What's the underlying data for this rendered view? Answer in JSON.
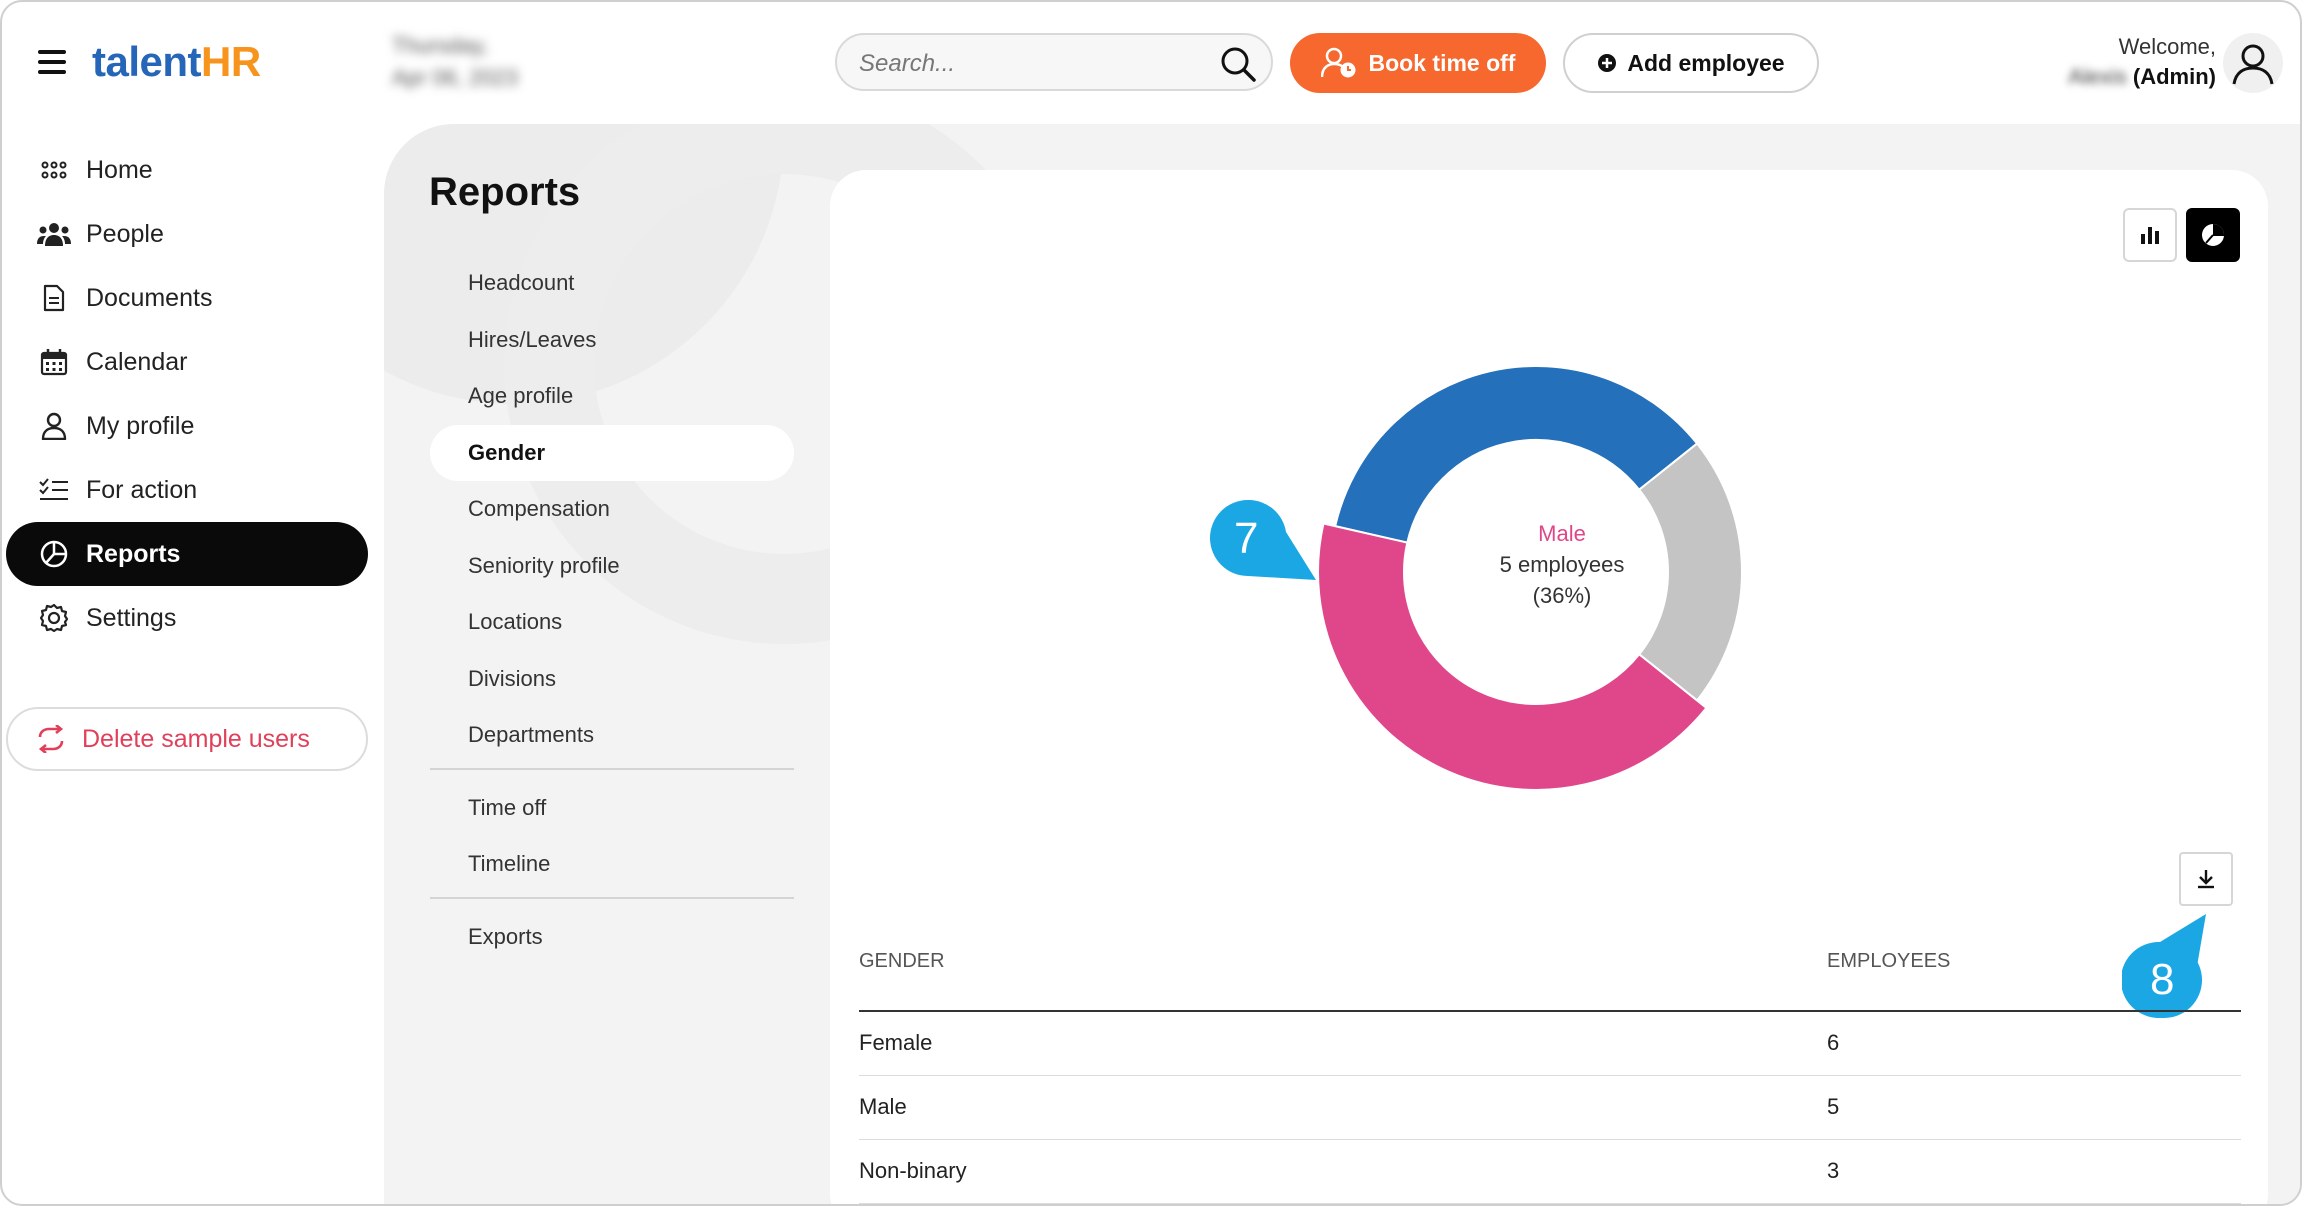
{
  "app": {
    "logo_part1": "talent",
    "logo_part2": "HR",
    "date_line1": "Thursday,",
    "date_line2": "Apr 06, 2023"
  },
  "header": {
    "search_placeholder": "Search...",
    "book_time_off": "Book time off",
    "add_employee": "Add employee",
    "welcome": "Welcome,",
    "user_name": "Alexis",
    "user_role": "(Admin)"
  },
  "sidebar": {
    "items": [
      {
        "label": "Home",
        "icon": "grid-icon"
      },
      {
        "label": "People",
        "icon": "people-icon"
      },
      {
        "label": "Documents",
        "icon": "document-icon"
      },
      {
        "label": "Calendar",
        "icon": "calendar-icon"
      },
      {
        "label": "My profile",
        "icon": "user-icon"
      },
      {
        "label": "For action",
        "icon": "checklist-icon"
      },
      {
        "label": "Reports",
        "icon": "pie-chart-icon",
        "active": true
      },
      {
        "label": "Settings",
        "icon": "gear-icon"
      }
    ],
    "delete_sample_users": "Delete sample users"
  },
  "reports": {
    "title": "Reports",
    "menu_group1": [
      "Headcount",
      "Hires/Leaves",
      "Age profile",
      "Gender",
      "Compensation",
      "Seniority profile",
      "Locations",
      "Divisions",
      "Departments"
    ],
    "active_item": "Gender",
    "menu_group2": [
      "Time off",
      "Timeline"
    ],
    "menu_group3": [
      "Exports"
    ]
  },
  "chart": {
    "view_toggle_active": "pie",
    "center_category": "Male",
    "center_count": "5 employees",
    "center_percent": "(36%)",
    "colors": {
      "Female": "#e0478a",
      "Male": "#2470bb",
      "Non-binary": "#c4c4c4"
    }
  },
  "chart_data": {
    "type": "pie",
    "categories": [
      "Female",
      "Male",
      "Non-binary"
    ],
    "values": [
      6,
      5,
      3
    ]
  },
  "callouts": {
    "seven": "7",
    "eight": "8"
  },
  "table": {
    "headers": [
      "GENDER",
      "EMPLOYEES"
    ],
    "rows": [
      {
        "gender": "Female",
        "employees": "6"
      },
      {
        "gender": "Male",
        "employees": "5"
      },
      {
        "gender": "Non-binary",
        "employees": "3"
      }
    ]
  }
}
